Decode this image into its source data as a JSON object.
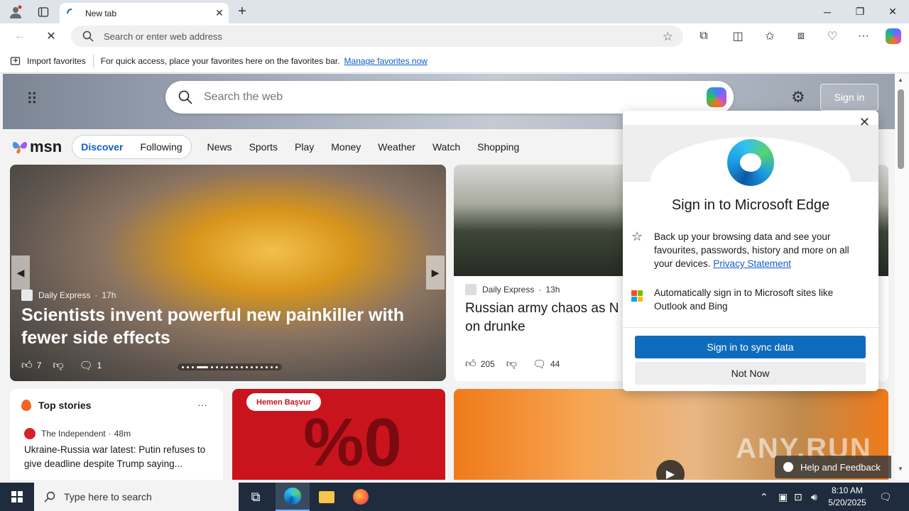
{
  "browser": {
    "tab_title": "New tab",
    "address_placeholder": "Search or enter web address"
  },
  "favbar": {
    "import_label": "Import favorites",
    "hint": "For quick access, place your favorites here on the favorites bar.",
    "manage_link": "Manage favorites now"
  },
  "page": {
    "search_placeholder": "Search the web",
    "signin_label": "Sign in",
    "msn_logo": "msn",
    "feed_tabs": [
      "Discover",
      "Following"
    ],
    "nav_links": [
      "News",
      "Sports",
      "Play",
      "Money",
      "Weather",
      "Watch",
      "Shopping"
    ]
  },
  "main_story": {
    "source": "Daily Express",
    "age": "17h",
    "headline": "Scientists invent powerful new painkiller with fewer side effects",
    "likes": "7",
    "comments": "1"
  },
  "second_story": {
    "source": "Daily Express",
    "age": "13h",
    "headline": "Russian army chaos as N Korean discipline collaps and troops go on drunke",
    "likes": "205",
    "comments": "44"
  },
  "top_stories": {
    "title": "Top stories",
    "more": "···",
    "source": "The Independent",
    "age": "48m",
    "headline": "Ukraine-Russia war latest: Putin refuses to give deadline despite Trump saying..."
  },
  "ad": {
    "button": "Hemen Başvur",
    "text": "%0"
  },
  "popup": {
    "title": "Sign in to Microsoft Edge",
    "backup_text": "Back up your browsing data and see your favourites, passwords, history and more on all your devices.",
    "privacy_link": "Privacy Statement",
    "auto_text": "Automatically sign in to Microsoft sites like Outlook and Bing",
    "primary": "Sign in to sync data",
    "secondary": "Not Now"
  },
  "help": {
    "label": "Help and Feedback"
  },
  "watermark": "ANY.RUN",
  "taskbar": {
    "search_placeholder": "Type here to search",
    "time": "8:10 AM",
    "date": "5/20/2025"
  },
  "colors": {
    "accent": "#0f6cbd",
    "link": "#0f5ecb",
    "taskbar": "#1f2c3d"
  }
}
